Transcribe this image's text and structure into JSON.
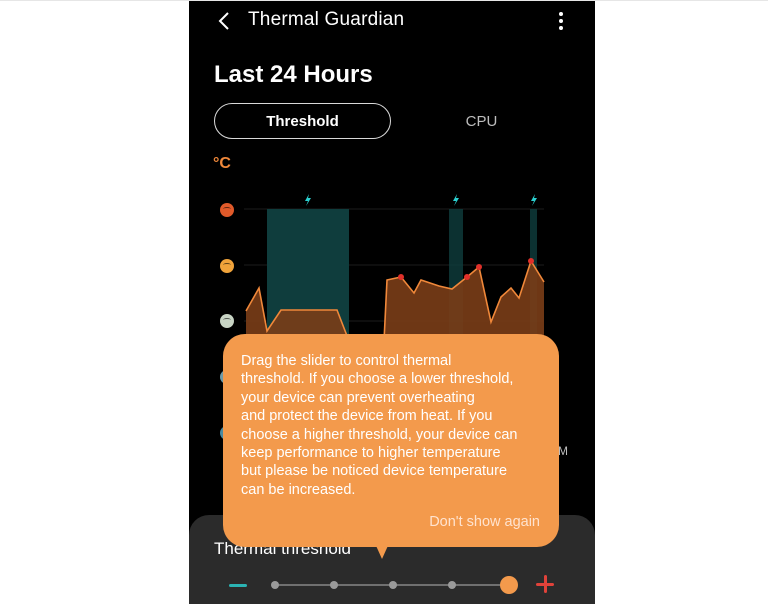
{
  "app_bar": {
    "title": "Thermal Guardian",
    "back_icon": "chevron-left-icon",
    "more_icon": "more-vertical-icon"
  },
  "page": {
    "title": "Last 24 Hours",
    "unit": "°C"
  },
  "tabs": [
    {
      "label": "Threshold",
      "selected": true
    },
    {
      "label": "CPU",
      "selected": false
    }
  ],
  "chart": {
    "level_icons": [
      "hot-face-icon",
      "warm-face-icon",
      "neutral-face-icon",
      "cool-face-icon",
      "cold-face-icon"
    ],
    "charging_icon": "lightning-icon",
    "time_label_tail": "M",
    "colors": {
      "area": "#7a3d17",
      "line": "#f0883a",
      "highlight": "#0f3d3d",
      "peak": "#e0302a",
      "bolt": "#2bd0d0"
    }
  },
  "tooltip": {
    "lines": [
      "Drag the slider to control thermal",
      "threshold. If you choose a lower threshold,",
      "your device can prevent overheating",
      "and protect the device from heat. If you",
      "choose a higher threshold, your device can",
      "keep performance to higher temperature",
      "but please be noticed device temperature",
      "can be increased."
    ],
    "dismiss_label": "Don't show again"
  },
  "threshold_sheet": {
    "title": "Thermal threshold",
    "steps": 5,
    "selected_step": 5,
    "decrease_icon": "minus-icon",
    "increase_icon": "plus-icon",
    "colors": {
      "decrease": "#2bb3b3",
      "increase": "#e0423a",
      "thumb": "#f39a4c"
    }
  }
}
